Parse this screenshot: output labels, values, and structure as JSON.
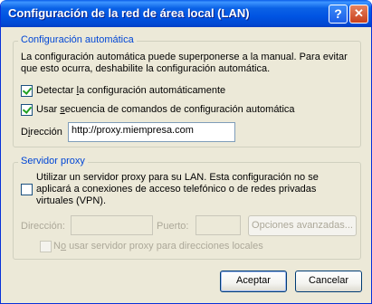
{
  "window": {
    "title": "Configuración de la red de área local (LAN)",
    "help_glyph": "?",
    "close_glyph": "✕"
  },
  "auto_config": {
    "legend": "Configuración automática",
    "description_line1": "La configuración automática puede superponerse a la manual. Para evitar",
    "description_line2": "que esto ocurra, deshabilite la configuración automática.",
    "detect": {
      "label_pre": "Detectar ",
      "label_key": "l",
      "label_post": "a configuración automáticamente",
      "checked": true
    },
    "script": {
      "label_pre": "Usar ",
      "label_key": "s",
      "label_post": "ecuencia de comandos de configuración automática",
      "checked": true
    },
    "address": {
      "label_pre": "D",
      "label_key": "i",
      "label_post": "rección",
      "value": "http://proxy.miempresa.com"
    }
  },
  "proxy": {
    "legend": "Servidor proxy",
    "use_proxy": {
      "line1": "Utilizar un servidor proxy para su LAN. Esta configuración no se",
      "line2": "aplicará a conexiones de acceso telefónico o de redes privadas",
      "line3": "virtuales (VPN).",
      "checked": false
    },
    "address_label": "Dirección:",
    "address_value": "",
    "port_label": "Puerto:",
    "port_value": "",
    "advanced_label": "Opciones avanzadas...",
    "bypass": {
      "label_pre": "N",
      "label_key": "o",
      "label_post": " usar servidor proxy para direcciones locales",
      "checked": false
    }
  },
  "buttons": {
    "ok": "Aceptar",
    "cancel": "Cancelar"
  }
}
